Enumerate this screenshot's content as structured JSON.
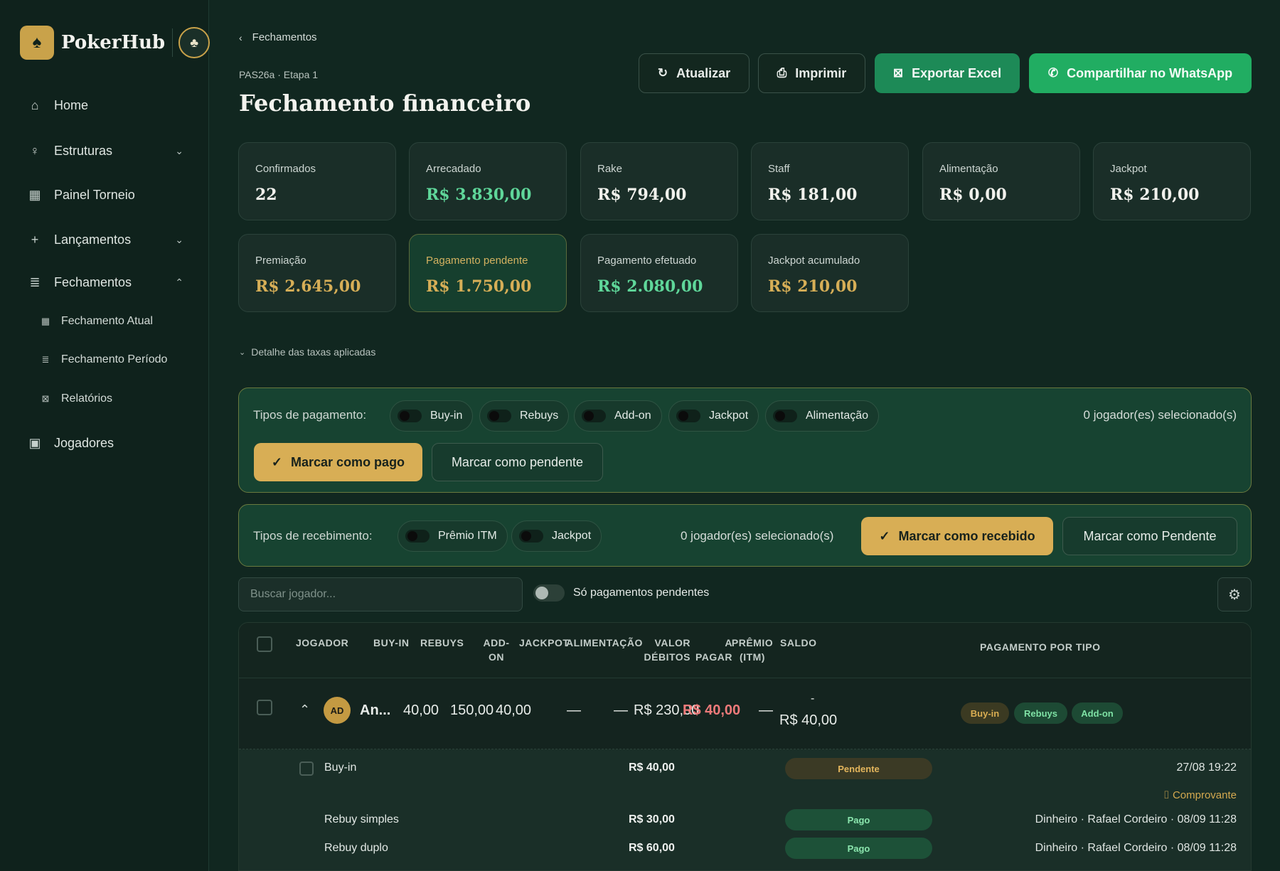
{
  "brand": {
    "name": "PokerHub"
  },
  "nav": {
    "home": "Home",
    "estruturas": "Estruturas",
    "painel": "Painel Torneio",
    "lancamentos": "Lançamentos",
    "fechamentos": "Fechamentos",
    "fech_atual": "Fechamento Atual",
    "fech_periodo": "Fechamento Período",
    "relatorios": "Relatórios",
    "jogadores": "Jogadores"
  },
  "header": {
    "breadcrumb": "Fechamentos",
    "subtitle": "PAS26a · Etapa 1",
    "title": "Fechamento financeiro",
    "btn_atualizar": "Atualizar",
    "btn_imprimir": "Imprimir",
    "btn_excel": "Exportar Excel",
    "btn_whatsapp": "Compartilhar no WhatsApp"
  },
  "stats": [
    {
      "label": "Confirmados",
      "value": "22"
    },
    {
      "label": "Arrecadado",
      "value": "R$ 3.830,00"
    },
    {
      "label": "Rake",
      "value": "R$ 794,00"
    },
    {
      "label": "Staff",
      "value": "R$ 181,00"
    },
    {
      "label": "Alimentação",
      "value": "R$ 0,00"
    },
    {
      "label": "Jackpot",
      "value": "R$ 210,00"
    },
    {
      "label": "Premiação",
      "value": "R$ 2.645,00"
    },
    {
      "label": "Pagamento pendente",
      "value": "R$ 1.750,00"
    },
    {
      "label": "Pagamento efetuado",
      "value": "R$ 2.080,00"
    },
    {
      "label": "Jackpot acumulado",
      "value": "R$ 210,00"
    }
  ],
  "detail_toggle": "Detalhe das taxas aplicadas",
  "payment": {
    "label": "Tipos de pagamento:",
    "types": [
      "Buy-in",
      "Rebuys",
      "Add-on",
      "Jackpot",
      "Alimentação"
    ],
    "selected": "0 jogador(es) selecionado(s)",
    "btn_pago": "Marcar como pago",
    "btn_pendente": "Marcar como pendente"
  },
  "receipt": {
    "label": "Tipos de recebimento:",
    "types": [
      "Prêmio ITM",
      "Jackpot"
    ],
    "selected": "0 jogador(es) selecionado(s)",
    "btn_recebido": "Marcar como recebido",
    "btn_pendente": "Marcar como Pendente"
  },
  "filters": {
    "search_placeholder": "Buscar jogador...",
    "only_pending": "Só pagamentos pendentes"
  },
  "table": {
    "headers": {
      "jogador": "JOGADOR",
      "buyin": "BUY-IN",
      "rebuys": "REBUYS",
      "addon": "ADD-\nON",
      "jackpot": "JACKPOT",
      "alimentacao": "ALIMENTAÇÃO",
      "valor_debitos": "VALOR\nDÉBITOS",
      "a_pagar": "A\nPAGAR",
      "premio": "PRÊMIO\n(ITM)",
      "saldo": "SALDO",
      "pagamento_tipo": "PAGAMENTO POR TIPO"
    },
    "row": {
      "initials": "AD",
      "name": "An...",
      "buyin": "40,00",
      "rebuys": "150,00",
      "addon": "40,00",
      "jackpot": "—",
      "alimentacao": "—",
      "valor_debitos": "R$ 230,00",
      "a_pagar": "R$ 40,00",
      "premio": "—",
      "saldo_sign": "-",
      "saldo": "R$ 40,00",
      "tags": [
        "Buy-in",
        "Rebuys",
        "Add-on"
      ]
    },
    "subrows": [
      {
        "label": "Buy-in",
        "value": "R$ 40,00",
        "status": "Pendente",
        "info": "27/08 19:22",
        "link": "Comprovante"
      },
      {
        "label": "Rebuy simples",
        "value": "R$ 30,00",
        "status": "Pago",
        "info": "Dinheiro · Rafael Cordeiro · 08/09 11:28"
      },
      {
        "label": "Rebuy duplo",
        "value": "R$ 60,00",
        "status": "Pago",
        "info": "Dinheiro · Rafael Cordeiro · 08/09 11:28"
      }
    ]
  }
}
